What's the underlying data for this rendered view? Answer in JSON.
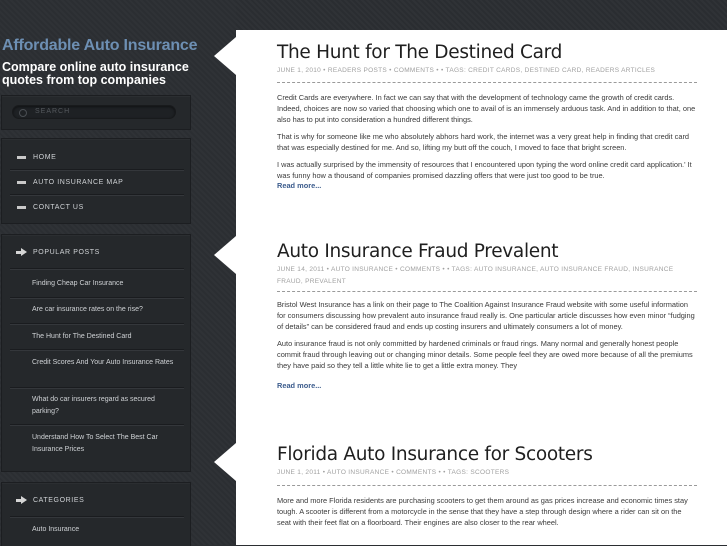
{
  "site": {
    "title": "Affordable Auto Insurance",
    "tagline": "Compare online auto insurance quotes from top companies"
  },
  "search": {
    "placeholder": "SEARCH"
  },
  "nav": {
    "items": [
      {
        "label": "HOME"
      },
      {
        "label": "AUTO INSURANCE MAP"
      },
      {
        "label": "CONTACT US"
      }
    ]
  },
  "popular_posts": {
    "heading": "POPULAR POSTS",
    "items": [
      {
        "label": "Finding Cheap Car Insurance"
      },
      {
        "label": "Are car insurance rates on the rise?"
      },
      {
        "label": "The Hunt for The Destined Card"
      },
      {
        "label": "Credit Scores And Your Auto Insurance Rates"
      },
      {
        "label": "What do car insurers regard as secured parking?"
      },
      {
        "label": "Understand How To Select The Best Car Insurance Prices"
      }
    ]
  },
  "categories": {
    "heading": "CATEGORIES",
    "items": [
      {
        "label": "Auto Insurance"
      }
    ]
  },
  "posts": [
    {
      "title": "The Hunt for The Destined Card",
      "date": "JUNE 1, 2010",
      "category": "READERS POSTS",
      "comments": "COMMENTS",
      "tags_label": "TAGS:",
      "tags": "CREDIT CARDS, DESTINED CARD, READERS ARTICLES",
      "paragraphs": [
        "Credit Cards are everywhere. In fact we can say that with the development of technology came the growth of credit cards. Indeed, choices are now so varied that choosing which one to avail of is an immensely arduous task. And in addition to that, one also has to put into consideration a hundred different things.",
        "That is why for someone like me who absolutely abhors hard work, the internet was a very great help in finding that credit card that was especially destined for me. And so, lifting my butt off the couch, I moved to face that bright screen.",
        "I was actually surprised by the immensity of resources that I encountered upon typing the word online credit card application.' It was funny how a thousand of companies promised dazzling offers that were just too good to be true."
      ],
      "read_more": "Read more..."
    },
    {
      "title": "Auto Insurance Fraud Prevalent",
      "date": "JUNE 14, 2011",
      "category": "AUTO INSURANCE",
      "comments": "COMMENTS",
      "tags_label": "TAGS:",
      "tags": "AUTO INSURANCE, AUTO INSURANCE FRAUD, INSURANCE FRAUD, PREVALENT",
      "paragraphs": [
        "Bristol West Insurance has a link on their page to The Coalition Against Insurance Fraud website with some useful information for consumers discussing how prevalent auto insurance fraud really is.  One particular article discusses how even minor “fudging of details” can be considered fraud and ends up costing insurers and ultimately consumers a lot of money.",
        "Auto insurance fraud is not only committed by hardened criminals or fraud rings.  Many normal and generally honest people commit fraud through leaving out or changing minor details.  Some people feel they are owed more because of all the premiums they have paid so they tell a little white lie to get a little extra money.  They"
      ],
      "read_more": "Read more..."
    },
    {
      "title": "Florida Auto Insurance for Scooters",
      "date": "JUNE 1, 2011",
      "category": "AUTO INSURANCE",
      "comments": "COMMENTS",
      "tags_label": "TAGS:",
      "tags": "SCOOTERS",
      "paragraphs": [
        "More and more Florida residents are purchasing scooters to get them around as gas prices increase and economic times stay tough.  A scooter is different from a motorcycle in the sense that they have a step through design where a rider can sit on the seat with their feet flat on a floorboard.  Their engines are also closer to the rear wheel."
      ],
      "read_more": ""
    }
  ]
}
